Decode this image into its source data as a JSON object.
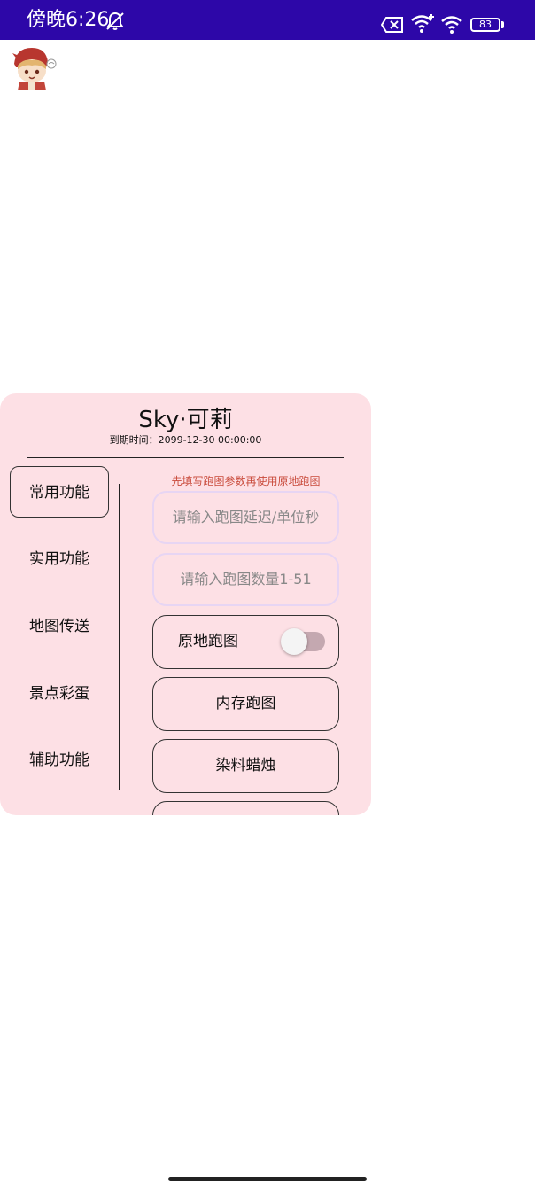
{
  "status_bar": {
    "time": "傍晚6:26",
    "battery": "83"
  },
  "panel": {
    "title": "Sky·可莉",
    "expiry": "到期时间：2099-12-30  00:00:00",
    "nav_items": [
      {
        "label": "常用功能",
        "active": true
      },
      {
        "label": "实用功能",
        "active": false
      },
      {
        "label": "地图传送",
        "active": false
      },
      {
        "label": "景点彩蛋",
        "active": false
      },
      {
        "label": "辅助功能",
        "active": false
      }
    ],
    "hint": "先填写跑图参数再使用原地跑图",
    "inputs": [
      {
        "placeholder": "请输入跑图延迟/单位秒",
        "value": ""
      },
      {
        "placeholder": "请输入跑图数量1-51",
        "value": ""
      }
    ],
    "switch": {
      "label": "原地跑图",
      "on": false
    },
    "buttons": [
      {
        "label": "内存跑图"
      },
      {
        "label": "染料蜡烛"
      }
    ]
  },
  "colors": {
    "status_bar": "#2d07a8",
    "panel_bg": "#fde0e5",
    "hint": "#c94a3a",
    "input_border": "#e7d5f3"
  }
}
